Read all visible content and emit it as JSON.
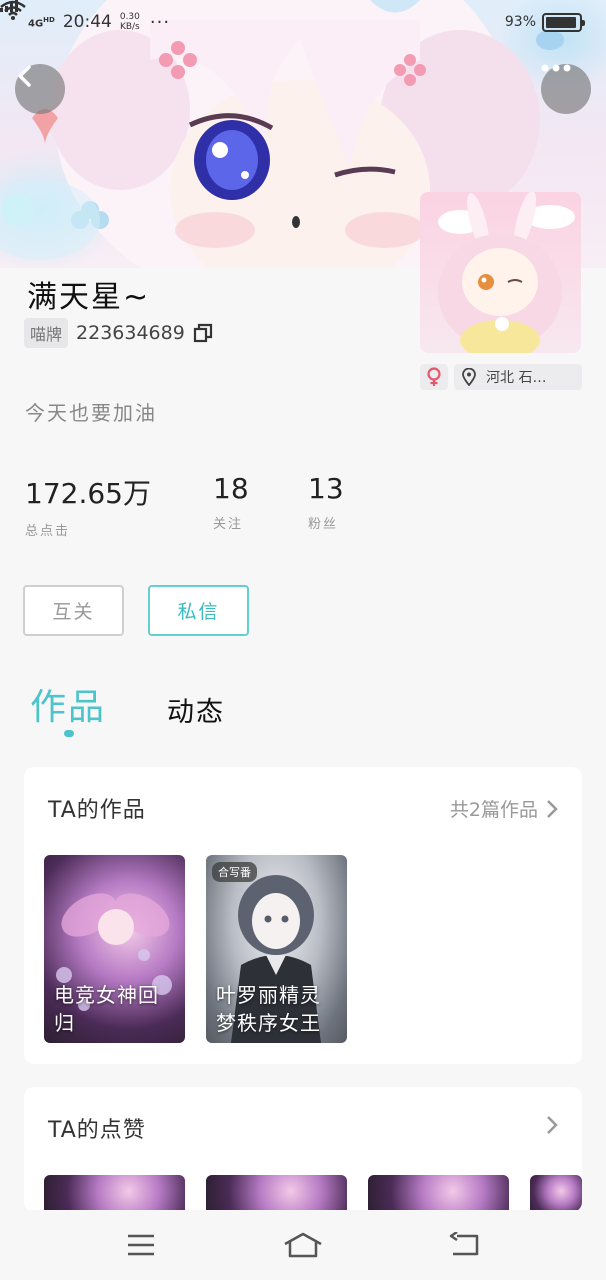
{
  "status_bar": {
    "network": "4G",
    "network_sup": "HD",
    "time": "20:44",
    "speed_value": "0.30",
    "speed_unit": "KB/s",
    "dots": "···",
    "battery_text": "93%",
    "battery_level": 0.93
  },
  "profile": {
    "name": "满天星~",
    "id_label": "喵牌",
    "id_number": "223634689",
    "bio": "今天也要加油",
    "location": "河北 石…"
  },
  "stats": [
    {
      "value": "172.65万",
      "label": "总点击"
    },
    {
      "value": "18",
      "label": "关注"
    },
    {
      "value": "13",
      "label": "粉丝"
    }
  ],
  "buttons": {
    "mutual": "互关",
    "message": "私信"
  },
  "tabs": {
    "works": "作品",
    "dynamic": "动态"
  },
  "works_card": {
    "title": "TA的作品",
    "more": "共2篇作品",
    "items": [
      {
        "caption": "电竞女神回归",
        "badge": ""
      },
      {
        "caption": "叶罗丽精灵梦秩序女王",
        "badge": "合写番"
      }
    ]
  },
  "likes_card": {
    "title": "TA的点赞"
  },
  "colors": {
    "accent": "#4dc4cb",
    "gender": "#e4576c"
  }
}
